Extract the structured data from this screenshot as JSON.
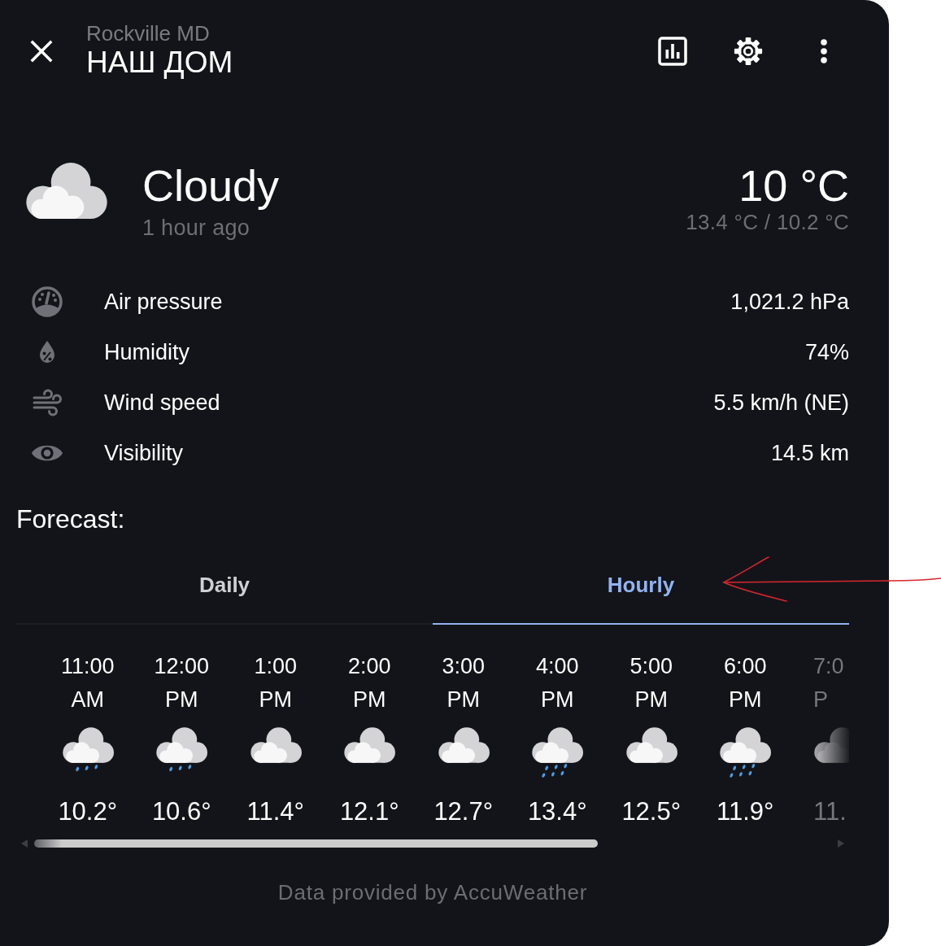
{
  "header": {
    "subtitle": "Rockville MD",
    "title": "НАШ ДОМ"
  },
  "weather": {
    "kind": "cloudy",
    "condition": "Cloudy",
    "updated": "1 hour ago",
    "temperature": "10 °C",
    "high_low": "13.4 °C / 10.2 °C"
  },
  "attributes": [
    {
      "kind": "pressure",
      "label": "Air pressure",
      "value": "1,021.2 hPa"
    },
    {
      "kind": "humidity",
      "label": "Humidity",
      "value": "74%"
    },
    {
      "kind": "wind",
      "label": "Wind speed",
      "value": "5.5 km/h (NE)"
    },
    {
      "kind": "visibility",
      "label": "Visibility",
      "value": "14.5 km"
    }
  ],
  "forecast": {
    "title": "Forecast:",
    "tabs": [
      {
        "label": "Daily",
        "selected": false
      },
      {
        "label": "Hourly",
        "selected": true
      }
    ],
    "hours": [
      {
        "kind": "rainy",
        "time": "11:00 AM",
        "temperature": "10.2°"
      },
      {
        "kind": "rainy",
        "time": "12:00 PM",
        "temperature": "10.6°"
      },
      {
        "kind": "cloudy",
        "time": "1:00 PM",
        "temperature": "11.4°"
      },
      {
        "kind": "cloudy",
        "time": "2:00 PM",
        "temperature": "12.1°"
      },
      {
        "kind": "cloudy",
        "time": "3:00 PM",
        "temperature": "12.7°"
      },
      {
        "kind": "pouring",
        "time": "4:00 PM",
        "temperature": "13.4°"
      },
      {
        "kind": "cloudy",
        "time": "5:00 PM",
        "temperature": "12.5°"
      },
      {
        "kind": "pouring",
        "time": "6:00 PM",
        "temperature": "11.9°"
      },
      {
        "kind": "cloudy",
        "time": "7:0 P",
        "temperature": "11."
      }
    ]
  },
  "attribution": "Data provided by AccuWeather"
}
